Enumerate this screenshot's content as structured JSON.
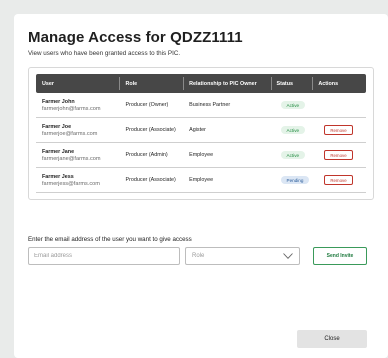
{
  "modal": {
    "title": "Manage Access for QDZZ1111",
    "subtitle": "View users who have been granted access to this PIC."
  },
  "table": {
    "headers": {
      "user": "User",
      "role": "Role",
      "relationship": "Relationship to PIC Owner",
      "status": "Status",
      "actions": "Actions"
    },
    "rows": [
      {
        "name": "Farmer John",
        "email": "farmerjohn@farms.com",
        "role": "Producer (Owner)",
        "relationship": "Business Partner",
        "status": "Active",
        "action": ""
      },
      {
        "name": "Farmer Joe",
        "email": "farmerjoe@farms.com",
        "role": "Producer (Associate)",
        "relationship": "Agister",
        "status": "Active",
        "action": "Remove"
      },
      {
        "name": "Farmer Jane",
        "email": "farmerjane@farms.com",
        "role": "Producer (Admin)",
        "relationship": "Employee",
        "status": "Active",
        "action": "Remove"
      },
      {
        "name": "Farmer Jess",
        "email": "farmerjess@farms.com",
        "role": "Producer (Associate)",
        "relationship": "Employee",
        "status": "Pending",
        "action": "Remove"
      }
    ]
  },
  "invite": {
    "label": "Enter the email address of the user you want to give access",
    "email_placeholder": "Email address",
    "role_placeholder": "Role",
    "send_label": "Send Invite"
  },
  "footer": {
    "close_label": "Close"
  },
  "colors": {
    "active_badge": "#1e8a3e",
    "pending_badge": "#2a5c9a",
    "remove": "#c0352b",
    "header_bg": "#474747"
  }
}
